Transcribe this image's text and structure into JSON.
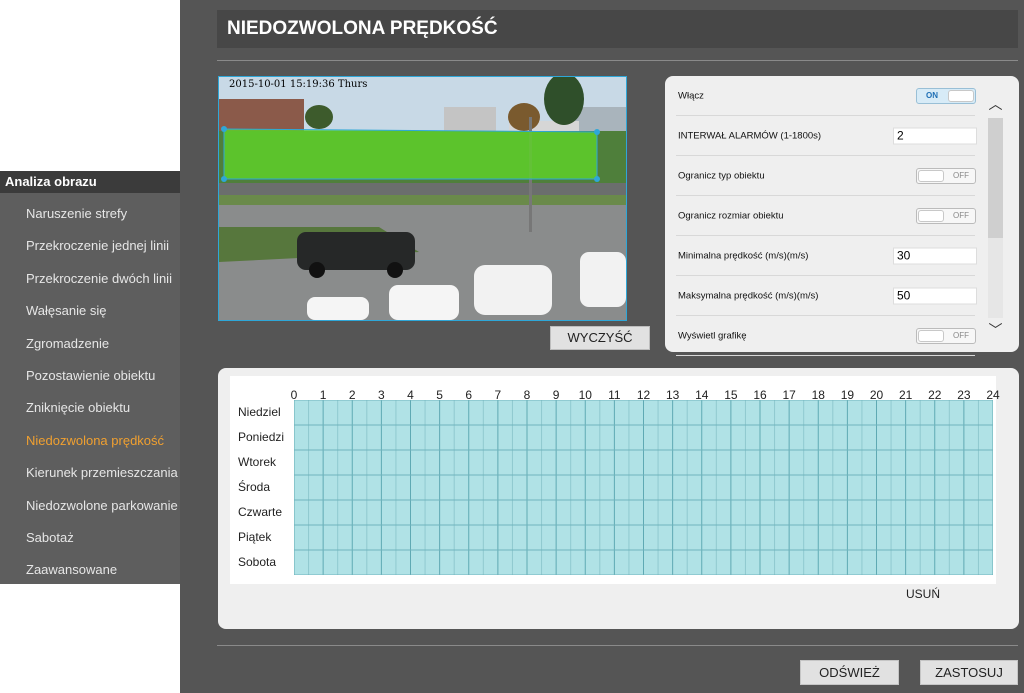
{
  "sidebar": {
    "header": "Analiza obrazu",
    "items": [
      {
        "label": "Naruszenie strefy",
        "active": false
      },
      {
        "label": "Przekroczenie jednej linii",
        "active": false
      },
      {
        "label": "Przekroczenie dwóch linii",
        "active": false
      },
      {
        "label": "Wałęsanie się",
        "active": false
      },
      {
        "label": "Zgromadzenie",
        "active": false
      },
      {
        "label": "Pozostawienie obiektu",
        "active": false
      },
      {
        "label": "Zniknięcie obiektu",
        "active": false
      },
      {
        "label": "Niedozwolona prędkość",
        "active": true
      },
      {
        "label": "Kierunek przemieszczania",
        "active": false
      },
      {
        "label": "Niedozwolone parkowanie",
        "active": false
      },
      {
        "label": "Sabotaż",
        "active": false
      },
      {
        "label": "Zaawansowane",
        "active": false
      }
    ]
  },
  "page": {
    "title": "NIEDOZWOLONA PRĘDKOŚĆ"
  },
  "video": {
    "timestamp": "2015-10-01 15:19:36 Thurs",
    "clear_button": "WYCZYŚĆ",
    "zone_color": "#5fd22a"
  },
  "settings": {
    "rows": [
      {
        "label": "Włącz",
        "type": "toggle",
        "state": "ON"
      },
      {
        "label": "INTERWAŁ ALARMÓW (1-1800s)",
        "type": "input",
        "value": "2"
      },
      {
        "label": "Ogranicz typ obiektu",
        "type": "toggle",
        "state": "OFF"
      },
      {
        "label": "Ogranicz rozmiar obiektu",
        "type": "toggle",
        "state": "OFF"
      },
      {
        "label": "Minimalna prędkość (m/s)(m/s)",
        "type": "input",
        "value": "30"
      },
      {
        "label": "Maksymalna prędkość (m/s)(m/s)",
        "type": "input",
        "value": "50"
      },
      {
        "label": "Wyświetl grafikę",
        "type": "toggle",
        "state": "OFF"
      }
    ],
    "scroll_up": "︿",
    "scroll_down": "﹀"
  },
  "schedule": {
    "hours": [
      "0",
      "1",
      "2",
      "3",
      "4",
      "5",
      "6",
      "7",
      "8",
      "9",
      "10",
      "11",
      "12",
      "13",
      "14",
      "15",
      "16",
      "17",
      "18",
      "19",
      "20",
      "21",
      "22",
      "23",
      "24"
    ],
    "days": [
      "Niedziel",
      "Poniedzi",
      "Wtorek",
      "Środa",
      "Czwarte",
      "Piątek",
      "Sobota"
    ],
    "delete_label": "USUŃ",
    "fill_color": "#b0e2e6"
  },
  "footer": {
    "refresh": "ODŚWIEŻ",
    "apply": "ZASTOSUJ"
  }
}
